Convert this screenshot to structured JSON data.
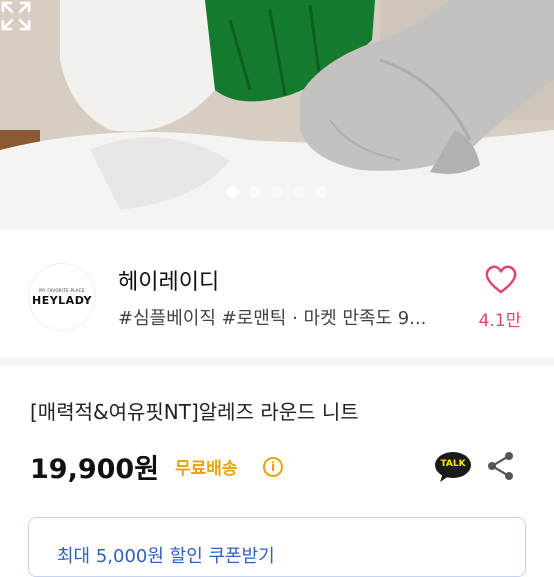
{
  "gallery": {
    "total_images": 5,
    "active_index": 0,
    "expand_icon": "expand-icon"
  },
  "shop": {
    "logo_tagline": "MY FAVORITE PLACE",
    "logo_name": "HEYLADY",
    "name": "헤이레이디",
    "tags": "#심플베이직 #로맨틱 · 마켓 만족도 9...",
    "like_count": "4.1만",
    "heart_icon": "heart-outline-icon",
    "accent_color": "#e0456b"
  },
  "product": {
    "title": "[매력적&여유핏NT]알레즈 라운드 니트",
    "price": "19,900원",
    "shipping": "무료배송",
    "shipping_color": "#e8a400",
    "info_icon_glyph": "i",
    "talk_label": "TALK",
    "share_icon": "share-icon"
  },
  "coupon": {
    "text": "최대 5,000원 할인 쿠폰받기"
  }
}
